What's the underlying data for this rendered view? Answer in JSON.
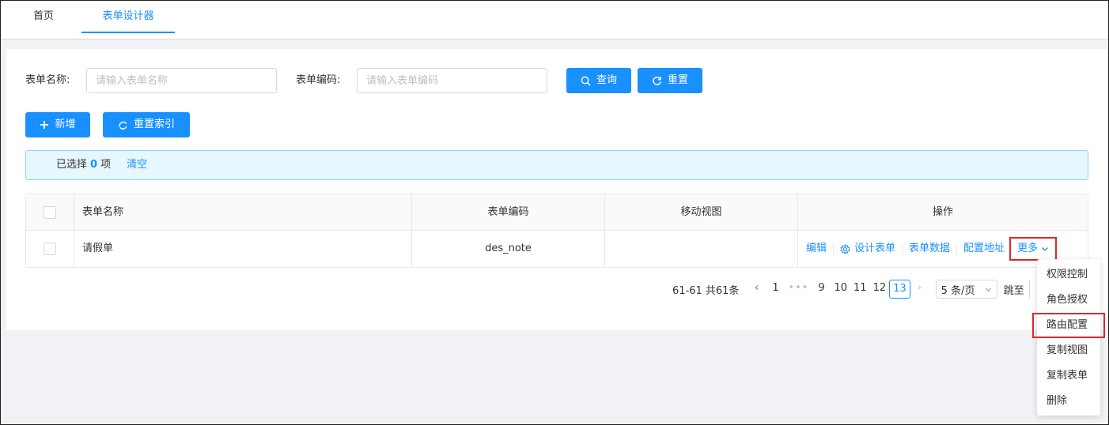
{
  "tabs": [
    {
      "label": "首页"
    },
    {
      "label": "表单设计器"
    }
  ],
  "search": {
    "name_label": "表单名称:",
    "name_placeholder": "请输入表单名称",
    "code_label": "表单编码:",
    "code_placeholder": "请输入表单编码",
    "query_button": "查询",
    "reset_button": "重置"
  },
  "toolbar": {
    "add_button": "新增",
    "reindex_button": "重置索引"
  },
  "selection": {
    "prefix": "已选择",
    "count": "0",
    "suffix": "项",
    "clear": "清空"
  },
  "table": {
    "columns": [
      "表单名称",
      "表单编码",
      "移动视图",
      "操作"
    ],
    "rows": [
      {
        "name": "请假单",
        "code": "des_note",
        "mobile": ""
      }
    ],
    "actions": [
      "编辑",
      "设计表单",
      "表单数据",
      "配置地址",
      "更多"
    ]
  },
  "pagination": {
    "range": "61-61 共61条",
    "pages": [
      "1",
      "9",
      "10",
      "11",
      "12",
      "13"
    ],
    "current": "13",
    "page_size": "5 条/页",
    "jump_label": "跳至"
  },
  "more_menu": [
    "权限控制",
    "角色授权",
    "路由配置",
    "复制视图",
    "复制表单",
    "删除"
  ],
  "colors": {
    "primary": "#1890ff",
    "highlight_border": "#e0262b"
  }
}
